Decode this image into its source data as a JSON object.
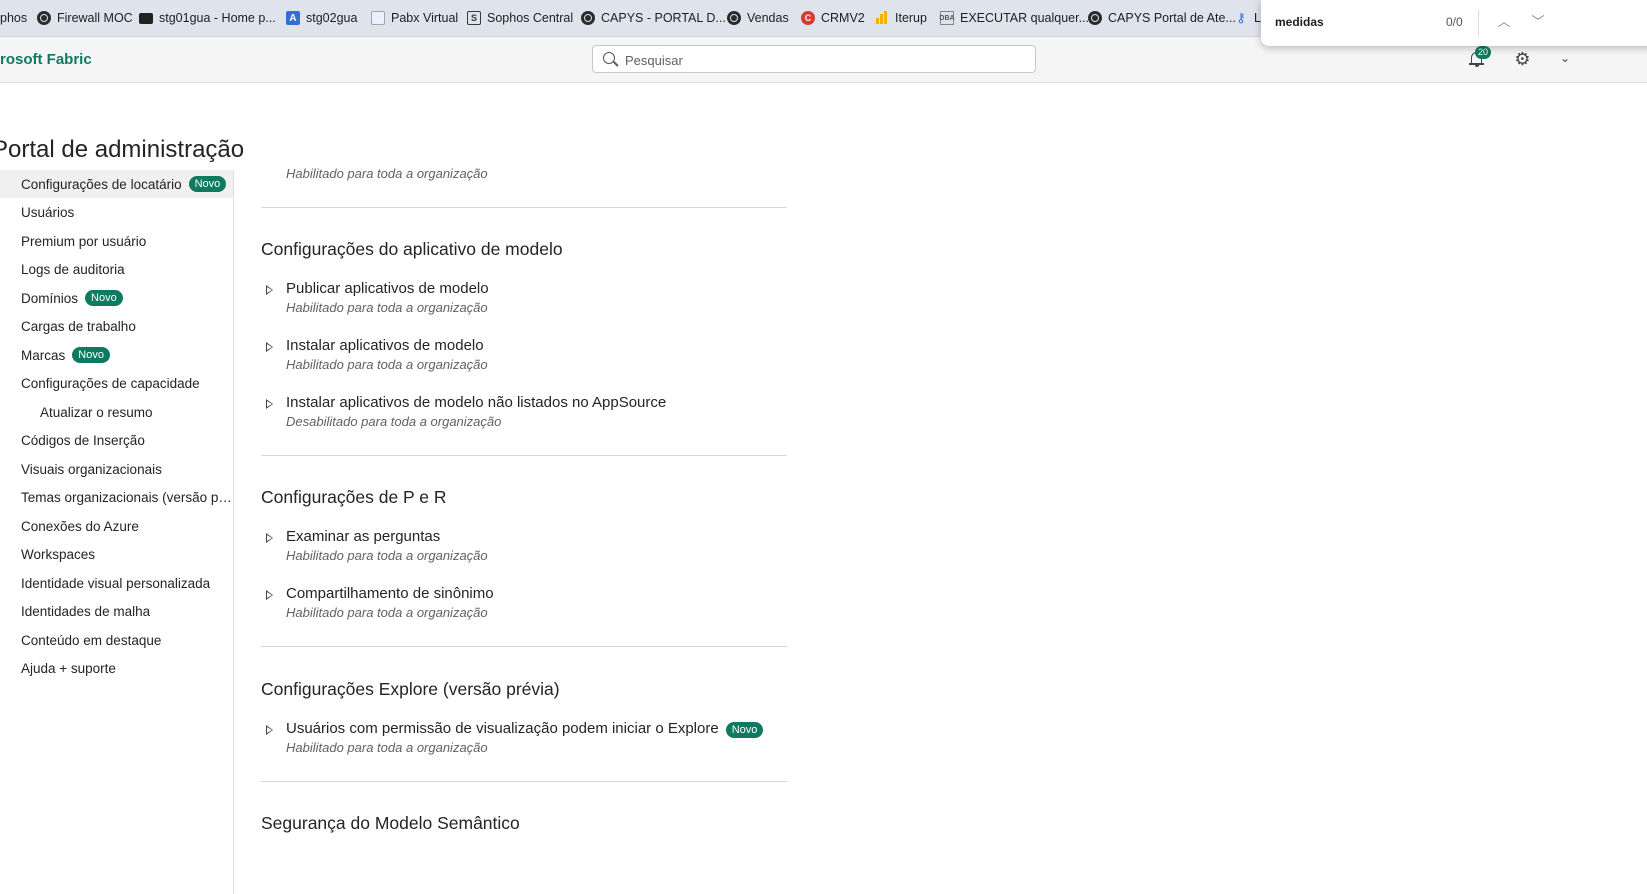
{
  "bookmarks": [
    {
      "label": "phos",
      "icon": "sophos-icon"
    },
    {
      "label": "Firewall MOC",
      "icon": "globe-icon"
    },
    {
      "label": "stg01gua - Home p...",
      "icon": "device-icon"
    },
    {
      "label": "stg02gua",
      "icon": "app-icon"
    },
    {
      "label": "Pabx Virtual",
      "icon": "grid-icon"
    },
    {
      "label": "Sophos Central",
      "icon": "sophos-s-icon"
    },
    {
      "label": "CAPYS - PORTAL D...",
      "icon": "globe-icon"
    },
    {
      "label": "Vendas",
      "icon": "globe-icon"
    },
    {
      "label": "CRMV2",
      "icon": "crm-icon"
    },
    {
      "label": "Iterup",
      "icon": "bars-icon"
    },
    {
      "label": "EXECUTAR qualquer...",
      "icon": "dba-icon"
    },
    {
      "label": "CAPYS Portal de Ate...",
      "icon": "globe-icon"
    },
    {
      "label": "L",
      "icon": "key-icon"
    }
  ],
  "find": {
    "query": "medidas",
    "count": "0/0"
  },
  "header": {
    "brand": "rosoft Fabric",
    "search_placeholder": "Pesquisar",
    "notifications": "20"
  },
  "page_title": "Portal de administração",
  "sidebar": {
    "items": [
      {
        "label": "Configurações de locatário",
        "badge": "Novo"
      },
      {
        "label": "Usuários",
        "badge": ""
      },
      {
        "label": "Premium por usuário",
        "badge": ""
      },
      {
        "label": "Logs de auditoria",
        "badge": ""
      },
      {
        "label": "Domínios",
        "badge": "Novo"
      },
      {
        "label": "Cargas de trabalho",
        "badge": ""
      },
      {
        "label": "Marcas",
        "badge": "Novo"
      },
      {
        "label": "Configurações de capacidade",
        "badge": ""
      },
      {
        "label": "Atualizar o resumo",
        "badge": ""
      },
      {
        "label": "Códigos de Inserção",
        "badge": ""
      },
      {
        "label": "Visuais organizacionais",
        "badge": ""
      },
      {
        "label": "Temas organizacionais (versão pré...",
        "badge": ""
      },
      {
        "label": "Conexões do Azure",
        "badge": ""
      },
      {
        "label": "Workspaces",
        "badge": ""
      },
      {
        "label": "Identidade visual personalizada",
        "badge": ""
      },
      {
        "label": "Identidades de malha",
        "badge": ""
      },
      {
        "label": "Conteúdo em destaque",
        "badge": ""
      },
      {
        "label": "Ajuda + suporte",
        "badge": ""
      }
    ]
  },
  "main": {
    "first_status": "Habilitado para toda a organização",
    "sections": [
      {
        "title": "Configurações do aplicativo de modelo",
        "settings": [
          {
            "title": "Publicar aplicativos de modelo",
            "status": "Habilitado para toda a organização",
            "badge": ""
          },
          {
            "title": "Instalar aplicativos de modelo",
            "status": "Habilitado para toda a organização",
            "badge": ""
          },
          {
            "title": "Instalar aplicativos de modelo não listados no AppSource",
            "status": "Desabilitado para toda a organização",
            "badge": ""
          }
        ]
      },
      {
        "title": "Configurações de P e R",
        "settings": [
          {
            "title": "Examinar as perguntas",
            "status": "Habilitado para toda a organização",
            "badge": ""
          },
          {
            "title": "Compartilhamento de sinônimo",
            "status": "Habilitado para toda a organização",
            "badge": ""
          }
        ]
      },
      {
        "title": "Configurações Explore (versão prévia)",
        "settings": [
          {
            "title": "Usuários com permissão de visualização podem iniciar o Explore",
            "status": "Habilitado para toda a organização",
            "badge": "Novo"
          }
        ]
      },
      {
        "title": "Segurança do Modelo Semântico",
        "settings": []
      }
    ]
  },
  "colors": {
    "accent": "#0e7a5f",
    "bookmarks_bg": "#dee3ec"
  }
}
